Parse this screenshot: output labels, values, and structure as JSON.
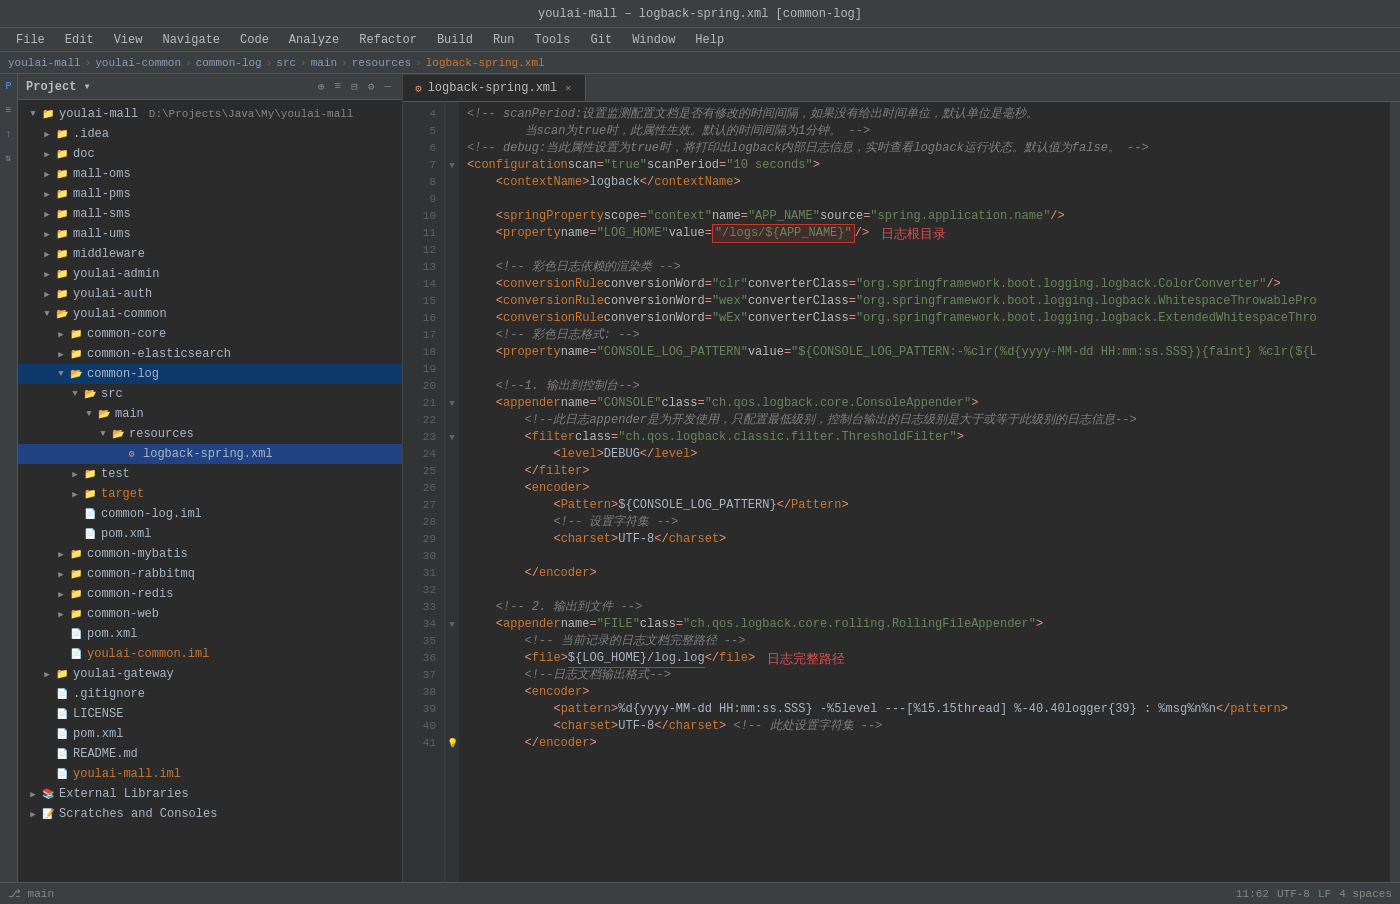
{
  "titleBar": {
    "text": "youlai-mall – logback-spring.xml [common-log]"
  },
  "menuBar": {
    "items": [
      "File",
      "Edit",
      "View",
      "Navigate",
      "Code",
      "Analyze",
      "Refactor",
      "Build",
      "Run",
      "Tools",
      "Git",
      "Window",
      "Help"
    ]
  },
  "breadcrumb": {
    "items": [
      "youlai-mall",
      "youlai-common",
      "common-log",
      "src",
      "main",
      "resources",
      "logback-spring.xml"
    ]
  },
  "panel": {
    "title": "Project",
    "actions": [
      "⊕",
      "≡",
      "⊟",
      "⚙",
      "—"
    ]
  },
  "tabs": [
    {
      "label": "logback-spring.xml",
      "active": true,
      "icon": "xml"
    }
  ],
  "fileTree": [
    {
      "indent": 0,
      "arrow": "▼",
      "icon": "project",
      "label": "youlai-mall",
      "extra": "D:\\Projects\\Java\\My\\youlai-mall",
      "type": "root"
    },
    {
      "indent": 1,
      "arrow": "▶",
      "icon": "folder",
      "label": ".idea",
      "type": "folder"
    },
    {
      "indent": 1,
      "arrow": "▶",
      "icon": "folder",
      "label": "doc",
      "type": "folder"
    },
    {
      "indent": 1,
      "arrow": "▶",
      "icon": "folder",
      "label": "mall-oms",
      "type": "folder"
    },
    {
      "indent": 1,
      "arrow": "▶",
      "icon": "folder",
      "label": "mall-pms",
      "type": "folder"
    },
    {
      "indent": 1,
      "arrow": "▶",
      "icon": "folder",
      "label": "mall-sms",
      "type": "folder"
    },
    {
      "indent": 1,
      "arrow": "▶",
      "icon": "folder",
      "label": "mall-ums",
      "type": "folder"
    },
    {
      "indent": 1,
      "arrow": "▶",
      "icon": "folder",
      "label": "middleware",
      "type": "folder"
    },
    {
      "indent": 1,
      "arrow": "▶",
      "icon": "folder",
      "label": "youlai-admin",
      "type": "folder"
    },
    {
      "indent": 1,
      "arrow": "▶",
      "icon": "folder",
      "label": "youlai-auth",
      "type": "folder"
    },
    {
      "indent": 1,
      "arrow": "▼",
      "icon": "folder-open",
      "label": "youlai-common",
      "type": "folder-open"
    },
    {
      "indent": 2,
      "arrow": "▶",
      "icon": "folder",
      "label": "common-core",
      "type": "folder"
    },
    {
      "indent": 2,
      "arrow": "▶",
      "icon": "folder",
      "label": "common-elasticsearch",
      "type": "folder"
    },
    {
      "indent": 2,
      "arrow": "▼",
      "icon": "folder-open",
      "label": "common-log",
      "type": "folder-open",
      "selected": true
    },
    {
      "indent": 3,
      "arrow": "▼",
      "icon": "src",
      "label": "src",
      "type": "folder-open"
    },
    {
      "indent": 4,
      "arrow": "▼",
      "icon": "folder-open",
      "label": "main",
      "type": "folder-open"
    },
    {
      "indent": 5,
      "arrow": "▼",
      "icon": "resources",
      "label": "resources",
      "type": "folder-open"
    },
    {
      "indent": 6,
      "arrow": "",
      "icon": "xml",
      "label": "logback-spring.xml",
      "type": "file-selected"
    },
    {
      "indent": 3,
      "arrow": "▶",
      "icon": "folder",
      "label": "test",
      "type": "folder"
    },
    {
      "indent": 3,
      "arrow": "▶",
      "icon": "folder-orange",
      "label": "target",
      "type": "folder-orange"
    },
    {
      "indent": 3,
      "arrow": "",
      "icon": "iml",
      "label": "common-log.iml",
      "type": "file"
    },
    {
      "indent": 3,
      "arrow": "",
      "icon": "pom",
      "label": "pom.xml",
      "type": "file"
    },
    {
      "indent": 2,
      "arrow": "▶",
      "icon": "folder",
      "label": "common-mybatis",
      "type": "folder"
    },
    {
      "indent": 2,
      "arrow": "▶",
      "icon": "folder",
      "label": "common-rabbitmq",
      "type": "folder"
    },
    {
      "indent": 2,
      "arrow": "▶",
      "icon": "folder",
      "label": "common-redis",
      "type": "folder"
    },
    {
      "indent": 2,
      "arrow": "▶",
      "icon": "folder",
      "label": "common-web",
      "type": "folder"
    },
    {
      "indent": 2,
      "arrow": "",
      "icon": "pom",
      "label": "pom.xml",
      "type": "file"
    },
    {
      "indent": 2,
      "arrow": "",
      "icon": "iml",
      "label": "youlai-common.iml",
      "type": "file"
    },
    {
      "indent": 1,
      "arrow": "▶",
      "icon": "folder",
      "label": "youlai-gateway",
      "type": "folder"
    },
    {
      "indent": 1,
      "arrow": "",
      "icon": "gitignore",
      "label": ".gitignore",
      "type": "file"
    },
    {
      "indent": 1,
      "arrow": "",
      "icon": "license",
      "label": "LICENSE",
      "type": "file"
    },
    {
      "indent": 1,
      "arrow": "",
      "icon": "pom",
      "label": "pom.xml",
      "type": "file"
    },
    {
      "indent": 1,
      "arrow": "",
      "icon": "readme",
      "label": "README.md",
      "type": "file"
    },
    {
      "indent": 1,
      "arrow": "",
      "icon": "iml",
      "label": "youlai-mall.iml",
      "type": "file"
    },
    {
      "indent": 0,
      "arrow": "▶",
      "icon": "libs",
      "label": "External Libraries",
      "type": "folder"
    },
    {
      "indent": 0,
      "arrow": "▶",
      "icon": "scratches",
      "label": "Scratches and Consoles",
      "type": "folder"
    }
  ],
  "codeLines": [
    {
      "num": 4,
      "content": "comment",
      "text": "<!-- scanPeriod:设置监测配置文档是否有修改的时间间隔，如果没有给出时间单位，默认单位是毫秒。"
    },
    {
      "num": 5,
      "content": "comment",
      "text": "        当scan为true时，此属性生效。默认的时间间隔为1分钟。-->"
    },
    {
      "num": 6,
      "content": "comment",
      "text": "<!-- debug:当此属性设置为true时，将打印出logback内部日志信息，实时查看logback运行状态。默认值为false。 -->"
    },
    {
      "num": 7,
      "content": "tag",
      "text": "<configuration scan=\"true\" scanPeriod=\"10 seconds\">"
    },
    {
      "num": 8,
      "content": "tag",
      "text": "    <contextName>logback</contextName>"
    },
    {
      "num": 9,
      "content": "empty"
    },
    {
      "num": 10,
      "content": "tag",
      "text": "    <springProperty scope=\"context\" name=\"APP_NAME\" source=\"spring.application.name\"/>"
    },
    {
      "num": 11,
      "content": "special-property",
      "text": "    <property name=\"LOG_HOME\" value=\"/logs/${APP_NAME}\" /> 日志根目录"
    },
    {
      "num": 12,
      "content": "empty"
    },
    {
      "num": 13,
      "content": "comment",
      "text": "    <!-- 彩色日志依赖的渲染类 -->"
    },
    {
      "num": 14,
      "content": "tag",
      "text": "    <conversionRule conversionWord=\"clr\" converterClass=\"org.springframework.boot.logging.logback.ColorConverter\" />"
    },
    {
      "num": 15,
      "content": "tag",
      "text": "    <conversionRule conversionWord=\"wex\" converterClass=\"org.springframework.boot.logging.logback.WhitespaceThrowablePro"
    },
    {
      "num": 16,
      "content": "tag",
      "text": "    <conversionRule conversionWord=\"wEx\" converterClass=\"org.springframework.boot.logging.logback.ExtendedWhitespaceThro"
    },
    {
      "num": 17,
      "content": "comment",
      "text": "    <!-- 彩色日志格式: -->"
    },
    {
      "num": 18,
      "content": "tag",
      "text": "    <property name=\"CONSOLE_LOG_PATTERN\" value=\"${CONSOLE_LOG_PATTERN:-%clr(%d{yyyy-MM-dd HH:mm:ss.SSS}){faint} %clr(${L"
    },
    {
      "num": 19,
      "content": "empty"
    },
    {
      "num": 20,
      "content": "comment",
      "text": "    <!--1. 输出到控制台-->"
    },
    {
      "num": 21,
      "content": "tag",
      "text": "    <appender name=\"CONSOLE\" class=\"ch.qos.logback.core.ConsoleAppender\">"
    },
    {
      "num": 22,
      "content": "comment",
      "text": "        <!--此日志appender是为开发使用，只配置最低级别，控制台输出的日志级别是大于或等于此级别的日志信息-->"
    },
    {
      "num": 23,
      "content": "tag",
      "text": "        <filter class=\"ch.qos.logback.classic.filter.ThresholdFilter\">"
    },
    {
      "num": 24,
      "content": "tag",
      "text": "            <level>DEBUG</level>"
    },
    {
      "num": 25,
      "content": "tag",
      "text": "        </filter>"
    },
    {
      "num": 26,
      "content": "tag",
      "text": "        <encoder>"
    },
    {
      "num": 27,
      "content": "tag",
      "text": "            <Pattern>${CONSOLE_LOG_PATTERN}</Pattern>"
    },
    {
      "num": 28,
      "content": "comment",
      "text": "            <!-- 设置字符集 -->"
    },
    {
      "num": 29,
      "content": "tag",
      "text": "            <charset>UTF-8</charset>"
    },
    {
      "num": 30,
      "content": "empty"
    },
    {
      "num": 31,
      "content": "tag",
      "text": "        </encoder>"
    },
    {
      "num": 32,
      "content": "empty"
    },
    {
      "num": 33,
      "content": "comment",
      "text": "    <!-- 2. 输出到文件  -->"
    },
    {
      "num": 34,
      "content": "tag",
      "text": "    <appender name=\"FILE\" class=\"ch.qos.logback.core.rolling.RollingFileAppender\">"
    },
    {
      "num": 35,
      "content": "comment",
      "text": "        <!-- 当前记录的日志文档完整路径  -->"
    },
    {
      "num": 36,
      "content": "special-file",
      "text": "        <file>${LOG_HOME}/log.log</file> 日志完整路径"
    },
    {
      "num": 37,
      "content": "comment",
      "text": "        <!--日志文档输出格式-->"
    },
    {
      "num": 38,
      "content": "tag",
      "text": "        <encoder>"
    },
    {
      "num": 39,
      "content": "tag",
      "text": "            <pattern>%d{yyyy-MM-dd HH:mm:ss.SSS} -%5level ---[%15.15thread] %-40.40logger{39} : %msg%n%n</pattern>"
    },
    {
      "num": 40,
      "content": "tag-hint",
      "text": "            <charset>UTF-8</charset> <!-- 此处设置字符集 -->"
    },
    {
      "num": 41,
      "content": "tag",
      "text": "        </encoder>"
    }
  ],
  "bottomBar": {
    "branch": "main",
    "encoding": "UTF-8",
    "lineEnding": "LF",
    "indent": "4 spaces",
    "position": "11:62"
  }
}
